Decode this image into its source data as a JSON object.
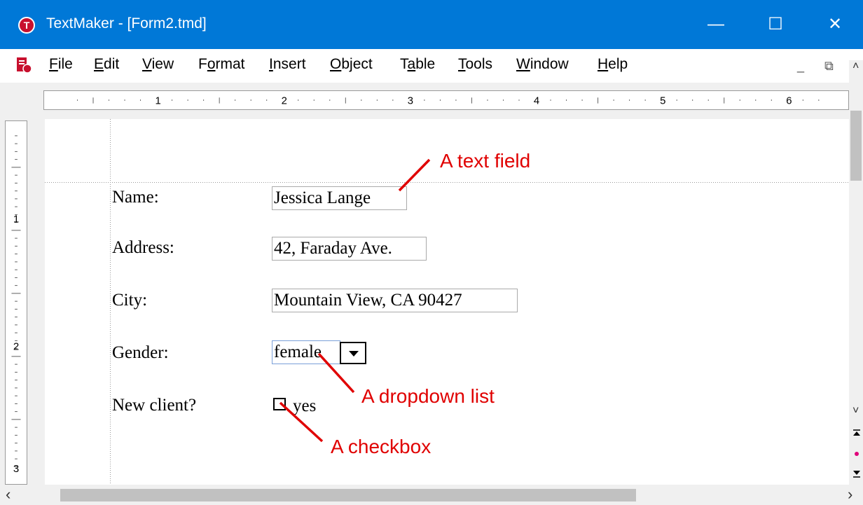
{
  "window": {
    "title": "TextMaker - [Form2.tmd]",
    "icon": "textmaker-icon",
    "min_glyph": "—",
    "max_glyph": "☐",
    "close_glyph": "✕"
  },
  "menu": {
    "items": [
      {
        "pre": "",
        "u": "F",
        "post": "ile"
      },
      {
        "pre": "",
        "u": "E",
        "post": "dit"
      },
      {
        "pre": "",
        "u": "V",
        "post": "iew"
      },
      {
        "pre": "F",
        "u": "o",
        "post": "rmat"
      },
      {
        "pre": "",
        "u": "I",
        "post": "nsert"
      },
      {
        "pre": "",
        "u": "O",
        "post": "bject"
      },
      {
        "pre": "T",
        "u": "a",
        "post": "ble"
      },
      {
        "pre": "",
        "u": "T",
        "post": "ools"
      },
      {
        "pre": "",
        "u": "W",
        "post": "indow"
      },
      {
        "pre": "",
        "u": "H",
        "post": "elp"
      }
    ],
    "mdi_min": "_",
    "mdi_restore": "⧉",
    "mdi_close": "×"
  },
  "ruler": {
    "h_labels": [
      "1",
      "2",
      "3",
      "4",
      "5",
      "6"
    ],
    "v_labels": [
      "1",
      "2",
      "3"
    ]
  },
  "form": {
    "name_label": "Name:",
    "name_value": "Jessica Lange",
    "address_label": "Address:",
    "address_value": "42, Faraday Ave.",
    "city_label": "City:",
    "city_value": "Mountain View, CA 90427",
    "gender_label": "Gender:",
    "gender_value": "female",
    "newclient_label": "New client?",
    "newclient_option": "yes"
  },
  "annotations": {
    "text_field": "A text field",
    "dropdown": "A dropdown list",
    "checkbox": "A checkbox"
  },
  "colors": {
    "accent": "#0078d7",
    "annotation": "#e00000"
  },
  "scroll": {
    "left": "‹",
    "right": "›",
    "up": "˄",
    "down": "˅"
  }
}
